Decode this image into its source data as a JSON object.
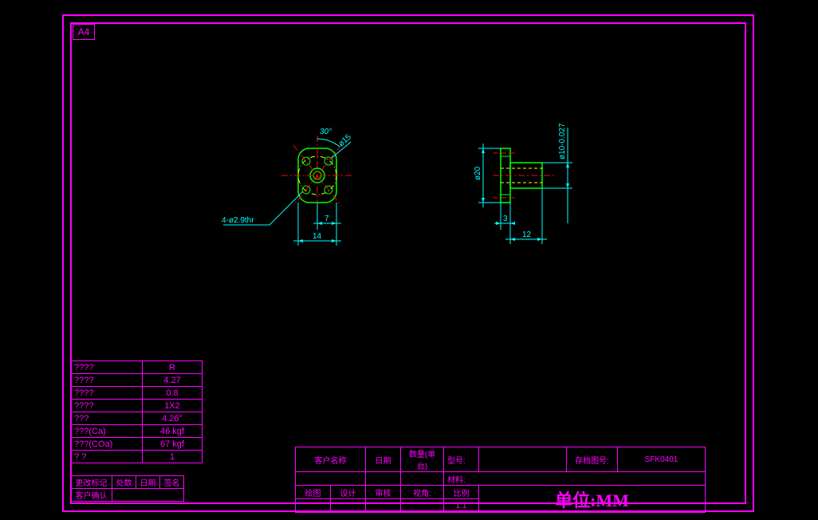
{
  "sheet": {
    "format": "A4"
  },
  "dims": {
    "angle": "30°",
    "lead_phi": "ø15",
    "hole_note": "4-ø2.9thr",
    "w7": "7",
    "w14": "14",
    "h20": "ø20",
    "t3": "3",
    "l12": "12",
    "d10": "ø10-0.027"
  },
  "spec": [
    {
      "k": "????",
      "v": "R"
    },
    {
      "k": "????",
      "v": "4.27"
    },
    {
      "k": "????",
      "v": "0.8"
    },
    {
      "k": "????",
      "v": "1X2"
    },
    {
      "k": "???",
      "v": "4.26°"
    },
    {
      "k": "???(Ca)",
      "v": "46 kgf"
    },
    {
      "k": "???(COa)",
      "v": "67 kgf"
    },
    {
      "k": "? ?",
      "v": "1"
    }
  ],
  "rev": {
    "h1": "更改标记",
    "h2": "处数",
    "h3": "日期",
    "h4": "签名",
    "r2": "客户确认"
  },
  "tb": {
    "r1": {
      "c1": "客户名称",
      "c2": "",
      "c3": "日期",
      "c4": "数量(单台)",
      "c5": "型号:",
      "c6": "",
      "c7": "存档图号:",
      "c8": "SFK0401"
    },
    "rm": {
      "c1": "",
      "c2": "",
      "c3": "",
      "c4": "",
      "c5": "材料:",
      "c6": ""
    },
    "r2": {
      "c1": "绘图",
      "c2": "设计",
      "c3": "审核",
      "c4": "视角:",
      "c5": "比例"
    },
    "r3": {
      "c1": "",
      "c2": "",
      "c3": "",
      "c4": "",
      "c5": "1:1"
    },
    "unit": "单位:MM"
  }
}
